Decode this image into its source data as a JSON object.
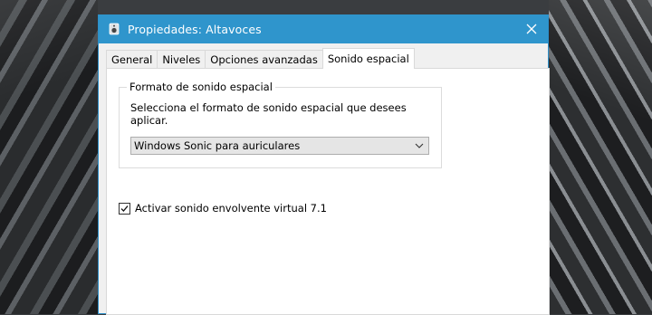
{
  "window": {
    "title": "Propiedades: Altavoces",
    "title_icon": "speaker-icon",
    "close_icon": "close-icon",
    "titlebar_color": "#2f95cc"
  },
  "tabs": [
    {
      "label": "General",
      "active": false
    },
    {
      "label": "Niveles",
      "active": false
    },
    {
      "label": "Opciones avanzadas",
      "active": false
    },
    {
      "label": "Sonido espacial",
      "active": true
    }
  ],
  "spatial": {
    "group_title": "Formato de sonido espacial",
    "description": "Selecciona el formato de sonido espacial que desees aplicar.",
    "format_selected": "Windows Sonic para auriculares",
    "dropdown_icon": "chevron-down-icon"
  },
  "virtual_surround": {
    "label": "Activar sonido envolvente virtual 7.1",
    "checked": true
  }
}
